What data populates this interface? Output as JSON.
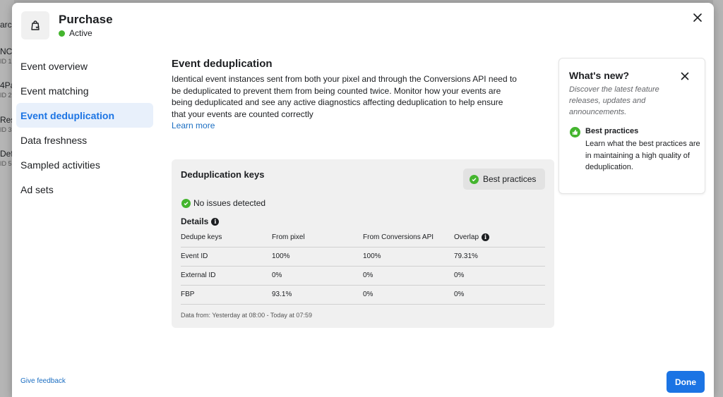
{
  "background": {
    "left_rows": [
      {
        "title": "arc",
        "sub": ""
      },
      {
        "title": "NC",
        "sub": "ID 1"
      },
      {
        "title": "4Pa",
        "sub": "ID 2"
      },
      {
        "title": "Res",
        "sub": "ID 3"
      },
      {
        "title": "Def",
        "sub": "ID 5"
      }
    ]
  },
  "header": {
    "title": "Purchase",
    "status": "Active",
    "icon": "shopping-bag-icon"
  },
  "nav": {
    "items": [
      {
        "label": "Event overview"
      },
      {
        "label": "Event matching"
      },
      {
        "label": "Event deduplication"
      },
      {
        "label": "Data freshness"
      },
      {
        "label": "Sampled activities"
      },
      {
        "label": "Ad sets"
      }
    ]
  },
  "main": {
    "title": "Event deduplication",
    "description": "Identical event instances sent from both your pixel and through the Conversions API need to be deduplicated to prevent them from being counted twice. Monitor how your events are being deduplicated and see any active diagnostics affecting deduplication to help ensure that your events are counted correctly",
    "learn_more": "Learn more"
  },
  "card": {
    "title": "Deduplication keys",
    "best_practices_button": "Best practices",
    "status": "No issues detected",
    "details_label": "Details",
    "columns": [
      "Dedupe keys",
      "From pixel",
      "From Conversions API",
      "Overlap"
    ],
    "rows": [
      [
        "Event ID",
        "100%",
        "100%",
        "79.31%"
      ],
      [
        "External ID",
        "0%",
        "0%",
        "0%"
      ],
      [
        "FBP",
        "93.1%",
        "0%",
        "0%"
      ]
    ],
    "data_from": "Data from: Yesterday at 08:00 - Today at 07:59"
  },
  "whats_new": {
    "title": "What's new?",
    "subtitle": "Discover the latest feature releases, updates and announcements.",
    "item_title": "Best practices",
    "item_text": "Learn what the best practices are in maintaining a high quality of deduplication."
  },
  "footer": {
    "feedback": "Give feedback",
    "done": "Done"
  },
  "colors": {
    "accent": "#1b74e4",
    "status_green": "#44b52e",
    "link": "#1b6ec2"
  }
}
